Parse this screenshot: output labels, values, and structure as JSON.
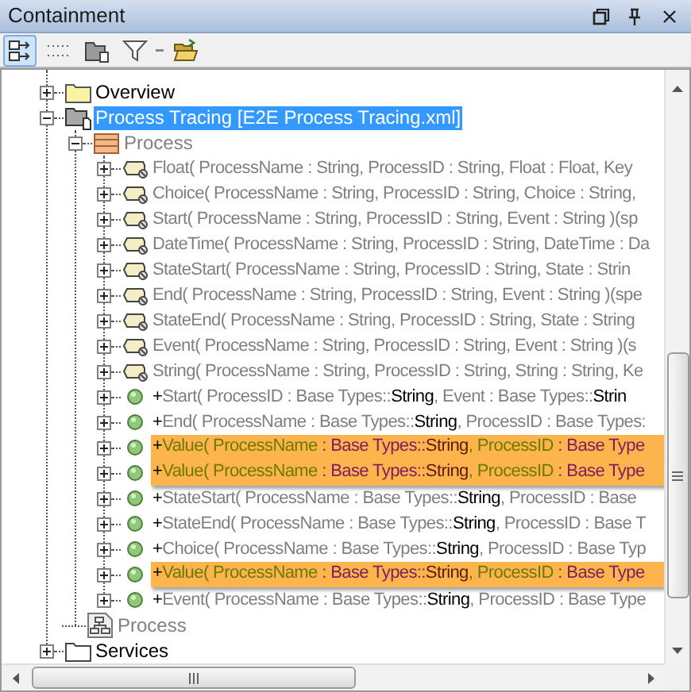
{
  "panel": {
    "title": "Containment"
  },
  "toolbar": [
    {
      "selected": true
    },
    {
      "selected": false
    },
    {
      "selected": false
    },
    {
      "selected": false
    }
  ],
  "tree": [
    {
      "kind": "folder",
      "label": "Overview",
      "expanded": false,
      "selected": false,
      "dimmed": false
    },
    {
      "kind": "package",
      "label": "Process Tracing [E2E Process Tracing.xml]",
      "expanded": true,
      "selected": true,
      "children": [
        {
          "kind": "class",
          "label": "Process",
          "expanded": true,
          "selected": false,
          "dimmed": true,
          "children": [
            {
              "kind": "signal",
              "expanded": false,
              "highlighted": false,
              "parts": [
                {
                  "kind": "name",
                  "text": "Float( ProcessName : String, ProcessID : String, Float : Float, Key"
                }
              ]
            },
            {
              "kind": "signal",
              "expanded": false,
              "highlighted": false,
              "parts": [
                {
                  "kind": "name",
                  "text": "Choice( ProcessName : String, ProcessID : String, Choice : String,"
                }
              ]
            },
            {
              "kind": "signal",
              "expanded": false,
              "highlighted": false,
              "parts": [
                {
                  "kind": "name",
                  "text": "Start( ProcessName : String, ProcessID : String, Event : String )(sp"
                }
              ]
            },
            {
              "kind": "signal",
              "expanded": false,
              "highlighted": false,
              "parts": [
                {
                  "kind": "name",
                  "text": "DateTime( ProcessName : String, ProcessID : String, DateTime : Da"
                }
              ]
            },
            {
              "kind": "signal",
              "expanded": false,
              "highlighted": false,
              "parts": [
                {
                  "kind": "name",
                  "text": "StateStart( ProcessName : String, ProcessID : String, State : Strin"
                }
              ]
            },
            {
              "kind": "signal",
              "expanded": false,
              "highlighted": false,
              "parts": [
                {
                  "kind": "name",
                  "text": "End( ProcessName : String, ProcessID : String, Event : String )(spe"
                }
              ]
            },
            {
              "kind": "signal",
              "expanded": false,
              "highlighted": false,
              "parts": [
                {
                  "kind": "name",
                  "text": "StateEnd( ProcessName : String, ProcessID : String, State : String"
                }
              ]
            },
            {
              "kind": "signal",
              "expanded": false,
              "highlighted": false,
              "parts": [
                {
                  "kind": "name",
                  "text": "Event( ProcessName : String, ProcessID : String, Event : String )(s"
                }
              ]
            },
            {
              "kind": "signal",
              "expanded": false,
              "highlighted": false,
              "parts": [
                {
                  "kind": "name",
                  "text": "String( ProcessName : String, ProcessID : String, String : String, Ke"
                }
              ]
            },
            {
              "kind": "operation",
              "expanded": false,
              "highlighted": false,
              "parts": [
                {
                  "kind": "sign",
                  "text": "+"
                },
                {
                  "kind": "name",
                  "text": "Start( ProcessID : Base Types::"
                },
                {
                  "kind": "type",
                  "text": "String"
                },
                {
                  "kind": "name",
                  "text": ", Event : Base Types::"
                },
                {
                  "kind": "type",
                  "text": "Strin"
                }
              ]
            },
            {
              "kind": "operation",
              "expanded": false,
              "highlighted": false,
              "parts": [
                {
                  "kind": "sign",
                  "text": "+"
                },
                {
                  "kind": "name",
                  "text": "End( ProcessName : Base Types::"
                },
                {
                  "kind": "type",
                  "text": "String"
                },
                {
                  "kind": "name",
                  "text": ", ProcessID : Base Types:"
                }
              ]
            },
            {
              "kind": "operation",
              "expanded": false,
              "highlighted": true,
              "parts": [
                {
                  "kind": "sign",
                  "text": "+"
                },
                {
                  "kind": "name",
                  "text": "Value( ProcessName "
                },
                {
                  "kind": "typeref",
                  "text": ": Base Types::"
                },
                {
                  "kind": "type",
                  "text": "String"
                },
                {
                  "kind": "name",
                  "text": ", ProcessID "
                },
                {
                  "kind": "typeref",
                  "text": ": Base Type"
                }
              ]
            },
            {
              "kind": "operation",
              "expanded": false,
              "highlighted": true,
              "parts": [
                {
                  "kind": "sign",
                  "text": "+"
                },
                {
                  "kind": "name",
                  "text": "Value( ProcessName "
                },
                {
                  "kind": "typeref",
                  "text": ": Base Types::"
                },
                {
                  "kind": "type",
                  "text": "String"
                },
                {
                  "kind": "name",
                  "text": ", ProcessID "
                },
                {
                  "kind": "typeref",
                  "text": ": Base Type"
                }
              ]
            },
            {
              "kind": "operation",
              "expanded": false,
              "highlighted": false,
              "parts": [
                {
                  "kind": "sign",
                  "text": "+"
                },
                {
                  "kind": "name",
                  "text": "StateStart( ProcessName : Base Types::"
                },
                {
                  "kind": "type",
                  "text": "String"
                },
                {
                  "kind": "name",
                  "text": ", ProcessID : Base"
                }
              ]
            },
            {
              "kind": "operation",
              "expanded": false,
              "highlighted": false,
              "parts": [
                {
                  "kind": "sign",
                  "text": "+"
                },
                {
                  "kind": "name",
                  "text": "StateEnd( ProcessName : Base Types::"
                },
                {
                  "kind": "type",
                  "text": "String"
                },
                {
                  "kind": "name",
                  "text": ", ProcessID : Base T"
                }
              ]
            },
            {
              "kind": "operation",
              "expanded": false,
              "highlighted": false,
              "parts": [
                {
                  "kind": "sign",
                  "text": "+"
                },
                {
                  "kind": "name",
                  "text": "Choice( ProcessName : Base Types::"
                },
                {
                  "kind": "type",
                  "text": "String"
                },
                {
                  "kind": "name",
                  "text": ", ProcessID : Base Typ"
                }
              ]
            },
            {
              "kind": "operation",
              "expanded": false,
              "highlighted": true,
              "parts": [
                {
                  "kind": "sign",
                  "text": "+"
                },
                {
                  "kind": "name",
                  "text": "Value( ProcessName "
                },
                {
                  "kind": "typeref",
                  "text": ": Base Types::"
                },
                {
                  "kind": "type",
                  "text": "String"
                },
                {
                  "kind": "name",
                  "text": ", ProcessID "
                },
                {
                  "kind": "typeref",
                  "text": ": Base Type"
                }
              ]
            },
            {
              "kind": "operation",
              "expanded": false,
              "highlighted": false,
              "parts": [
                {
                  "kind": "sign",
                  "text": "+"
                },
                {
                  "kind": "name",
                  "text": "Event( ProcessName : Base Types::"
                },
                {
                  "kind": "type",
                  "text": "String"
                },
                {
                  "kind": "name",
                  "text": ", ProcessID : Base Type"
                }
              ]
            }
          ]
        },
        {
          "kind": "diagram",
          "label": "Process",
          "selected": false,
          "dimmed": true
        }
      ]
    },
    {
      "kind": "plain_folder",
      "label": "Services",
      "expanded": false,
      "selected": false,
      "dimmed": false
    }
  ]
}
